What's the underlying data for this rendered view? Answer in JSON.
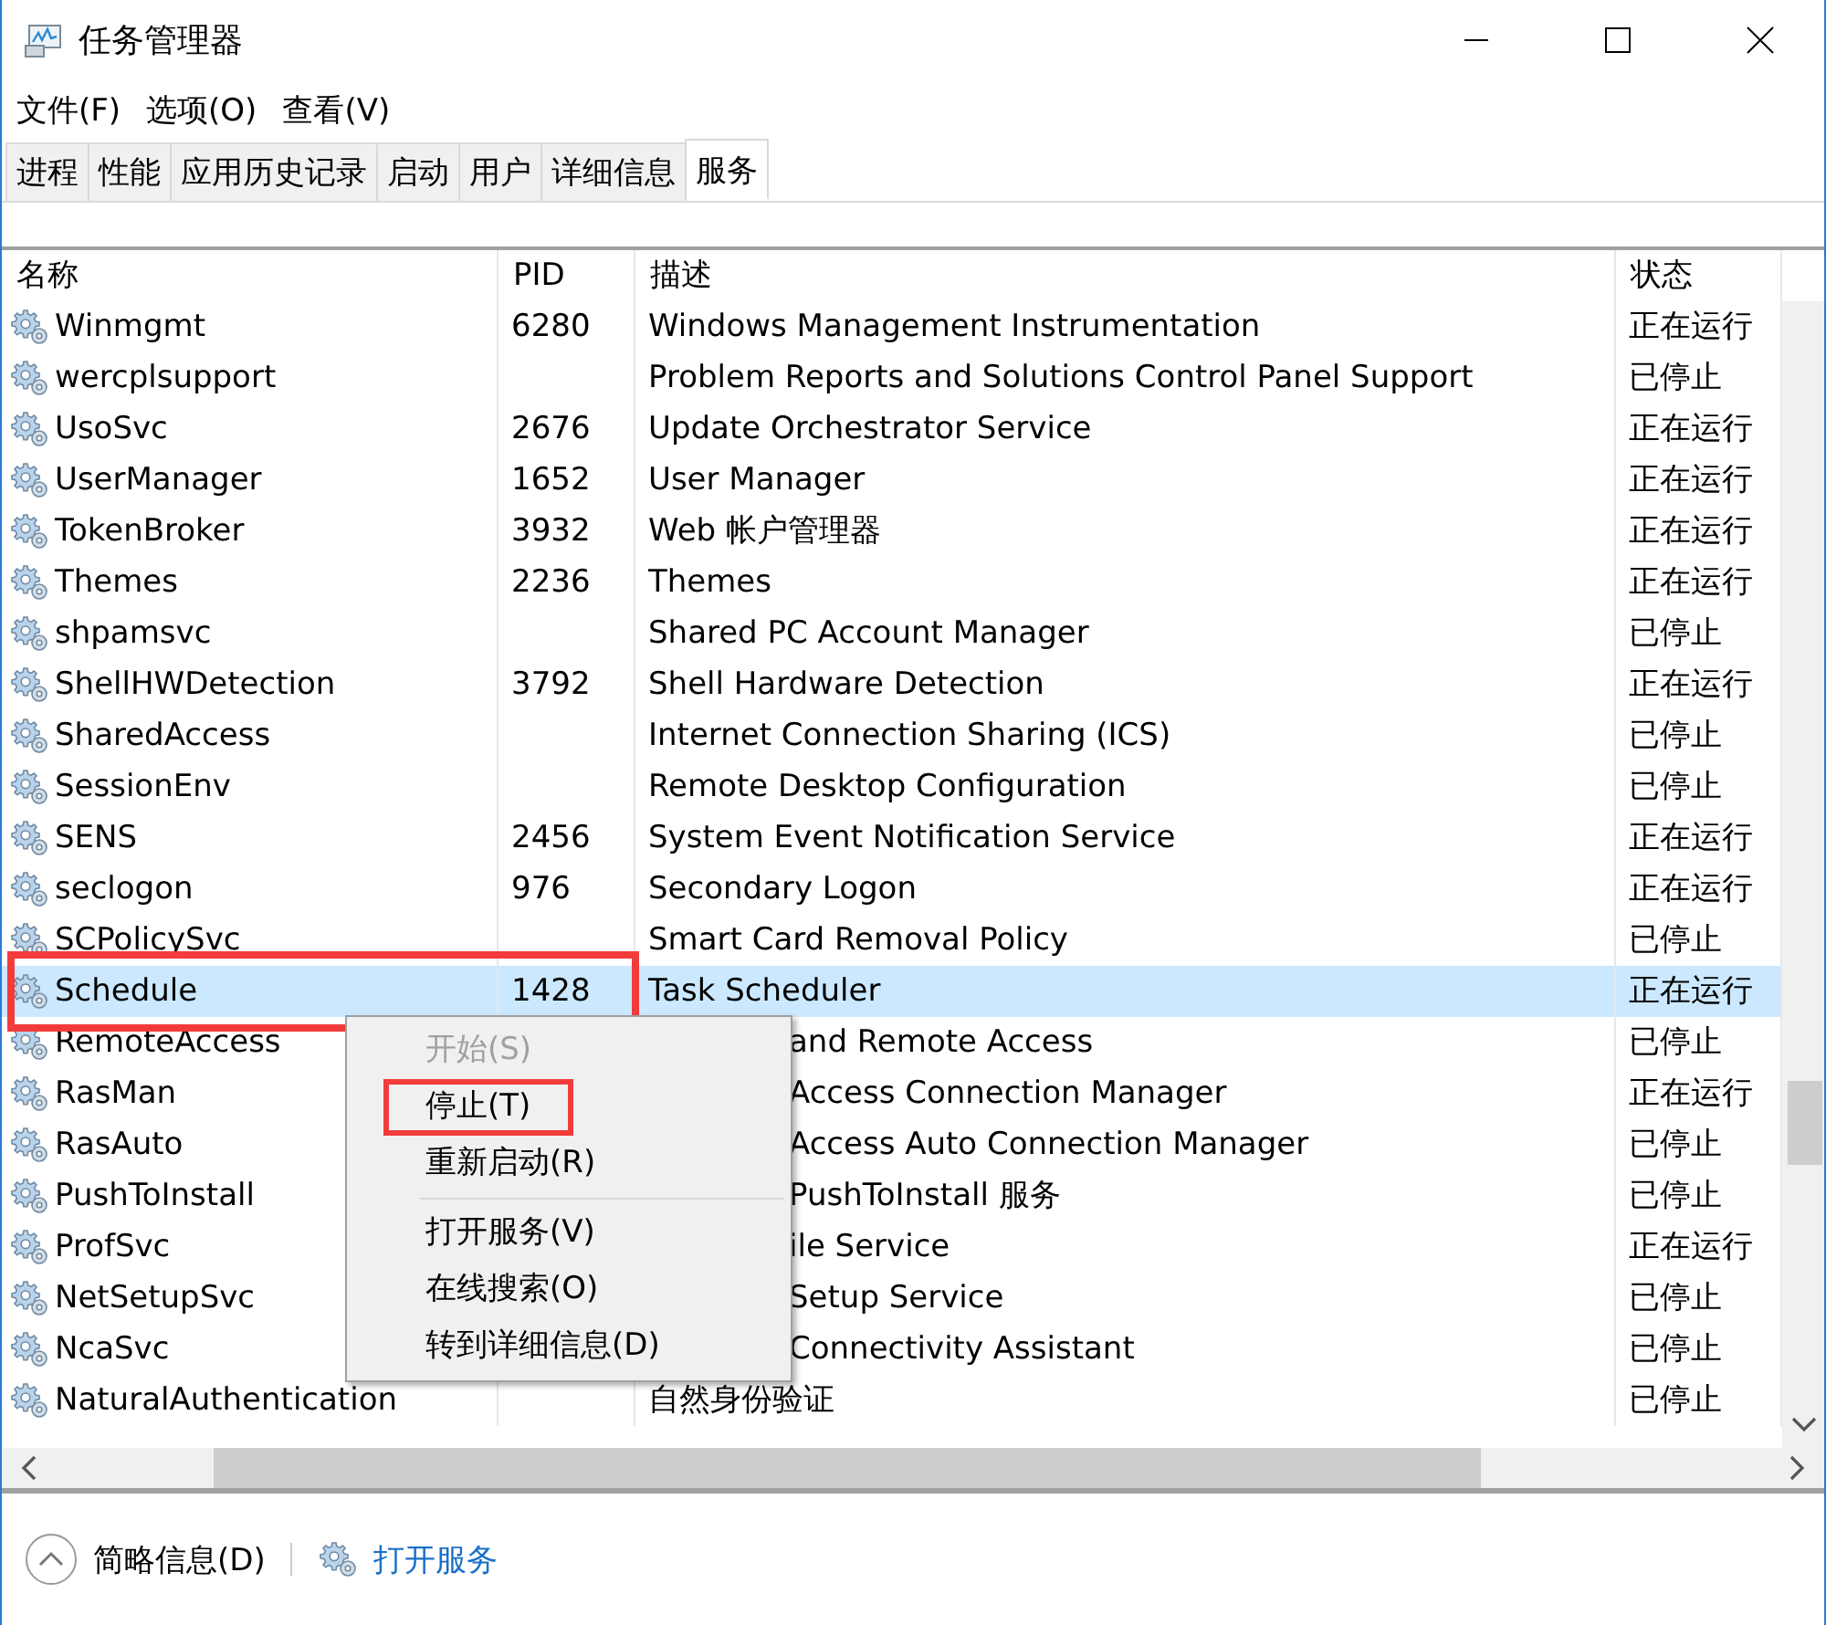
{
  "window": {
    "title": "任务管理器"
  },
  "menu_bar": [
    "文件(F)",
    "选项(O)",
    "查看(V)"
  ],
  "tabs": [
    {
      "label": "进程",
      "selected": false
    },
    {
      "label": "性能",
      "selected": false
    },
    {
      "label": "应用历史记录",
      "selected": false
    },
    {
      "label": "启动",
      "selected": false
    },
    {
      "label": "用户",
      "selected": false
    },
    {
      "label": "详细信息",
      "selected": false
    },
    {
      "label": "服务",
      "selected": true
    }
  ],
  "table": {
    "columns": [
      "名称",
      "PID",
      "描述",
      "状态"
    ],
    "rows": [
      {
        "name": "Winmgmt",
        "pid": "6280",
        "description": "Windows Management Instrumentation",
        "status": "正在运行",
        "selected": false,
        "highlighted": false,
        "occluded": false
      },
      {
        "name": "wercplsupport",
        "description": "Problem Reports and Solutions Control Panel Support",
        "status": "已停止",
        "selected": false,
        "highlighted": false,
        "occluded": false
      },
      {
        "name": "UsoSvc",
        "pid": "2676",
        "description": "Update Orchestrator Service",
        "status": "正在运行",
        "selected": false,
        "highlighted": false,
        "occluded": false
      },
      {
        "name": "UserManager",
        "pid": "1652",
        "description": "User Manager",
        "status": "正在运行",
        "selected": false,
        "highlighted": false,
        "occluded": false
      },
      {
        "name": "TokenBroker",
        "pid": "3932",
        "description": "Web 帐户管理器",
        "status": "正在运行",
        "selected": false,
        "highlighted": false,
        "occluded": false
      },
      {
        "name": "Themes",
        "pid": "2236",
        "description": "Themes",
        "status": "正在运行",
        "selected": false,
        "highlighted": false,
        "occluded": false
      },
      {
        "name": "shpamsvc",
        "description": "Shared PC Account Manager",
        "status": "已停止",
        "selected": false,
        "highlighted": false,
        "occluded": false
      },
      {
        "name": "ShellHWDetection",
        "pid": "3792",
        "description": "Shell Hardware Detection",
        "status": "正在运行",
        "selected": false,
        "highlighted": false,
        "occluded": false
      },
      {
        "name": "SharedAccess",
        "description": "Internet Connection Sharing (ICS)",
        "status": "已停止",
        "selected": false,
        "highlighted": false,
        "occluded": false
      },
      {
        "name": "SessionEnv",
        "description": "Remote Desktop Configuration",
        "status": "已停止",
        "selected": false,
        "highlighted": false,
        "occluded": false
      },
      {
        "name": "SENS",
        "pid": "2456",
        "description": "System Event Notification Service",
        "status": "正在运行",
        "selected": false,
        "highlighted": false,
        "occluded": false
      },
      {
        "name": "seclogon",
        "pid": "976",
        "description": "Secondary Logon",
        "status": "正在运行",
        "selected": false,
        "highlighted": false,
        "occluded": false
      },
      {
        "name": "SCPolicySvc",
        "description": "Smart Card Removal Policy",
        "status": "已停止",
        "selected": false,
        "highlighted": false,
        "occluded": false
      },
      {
        "name": "Schedule",
        "pid": "1428",
        "description": "Task Scheduler",
        "status": "正在运行",
        "selected": true,
        "highlighted": true,
        "occluded": false
      },
      {
        "name": "RemoteAccess",
        "description": "and Remote Access",
        "status": "已停止",
        "selected": false,
        "highlighted": false,
        "occluded": true
      },
      {
        "name": "RasMan",
        "description": "Access Connection Manager",
        "status": "正在运行",
        "selected": false,
        "highlighted": false,
        "occluded": true
      },
      {
        "name": "RasAuto",
        "description": "Access Auto Connection Manager",
        "status": "已停止",
        "selected": false,
        "highlighted": false,
        "occluded": true
      },
      {
        "name": "PushToInstall",
        "description": "PushToInstall 服务",
        "status": "已停止",
        "selected": false,
        "highlighted": false,
        "occluded": true
      },
      {
        "name": "ProfSvc",
        "description": "ile Service",
        "status": "正在运行",
        "selected": false,
        "highlighted": false,
        "occluded": true
      },
      {
        "name": "NetSetupSvc",
        "description": "Setup Service",
        "status": "已停止",
        "selected": false,
        "highlighted": false,
        "occluded": true
      },
      {
        "name": "NcaSvc",
        "description": "Connectivity Assistant",
        "status": "已停止",
        "selected": false,
        "highlighted": false,
        "occluded": true
      },
      {
        "name": "NaturalAuthentication",
        "description": "自然身份验证",
        "status": "已停止",
        "selected": false,
        "highlighted": false,
        "occluded": false
      }
    ]
  },
  "context_menu": [
    {
      "kind": "item",
      "label": "开始(S)",
      "disabled": true,
      "highlighted": false
    },
    {
      "kind": "item",
      "label": "停止(T)",
      "disabled": false,
      "highlighted": true
    },
    {
      "kind": "item",
      "label": "重新启动(R)",
      "disabled": false,
      "highlighted": false
    },
    {
      "kind": "separator"
    },
    {
      "kind": "item",
      "label": "打开服务(V)",
      "disabled": false,
      "highlighted": false
    },
    {
      "kind": "item",
      "label": "在线搜索(O)",
      "disabled": false,
      "highlighted": false
    },
    {
      "kind": "item",
      "label": "转到详细信息(D)",
      "disabled": false,
      "highlighted": false
    }
  ],
  "footer": {
    "details_toggle": "简略信息(D)",
    "open_services_link": "打开服务"
  }
}
